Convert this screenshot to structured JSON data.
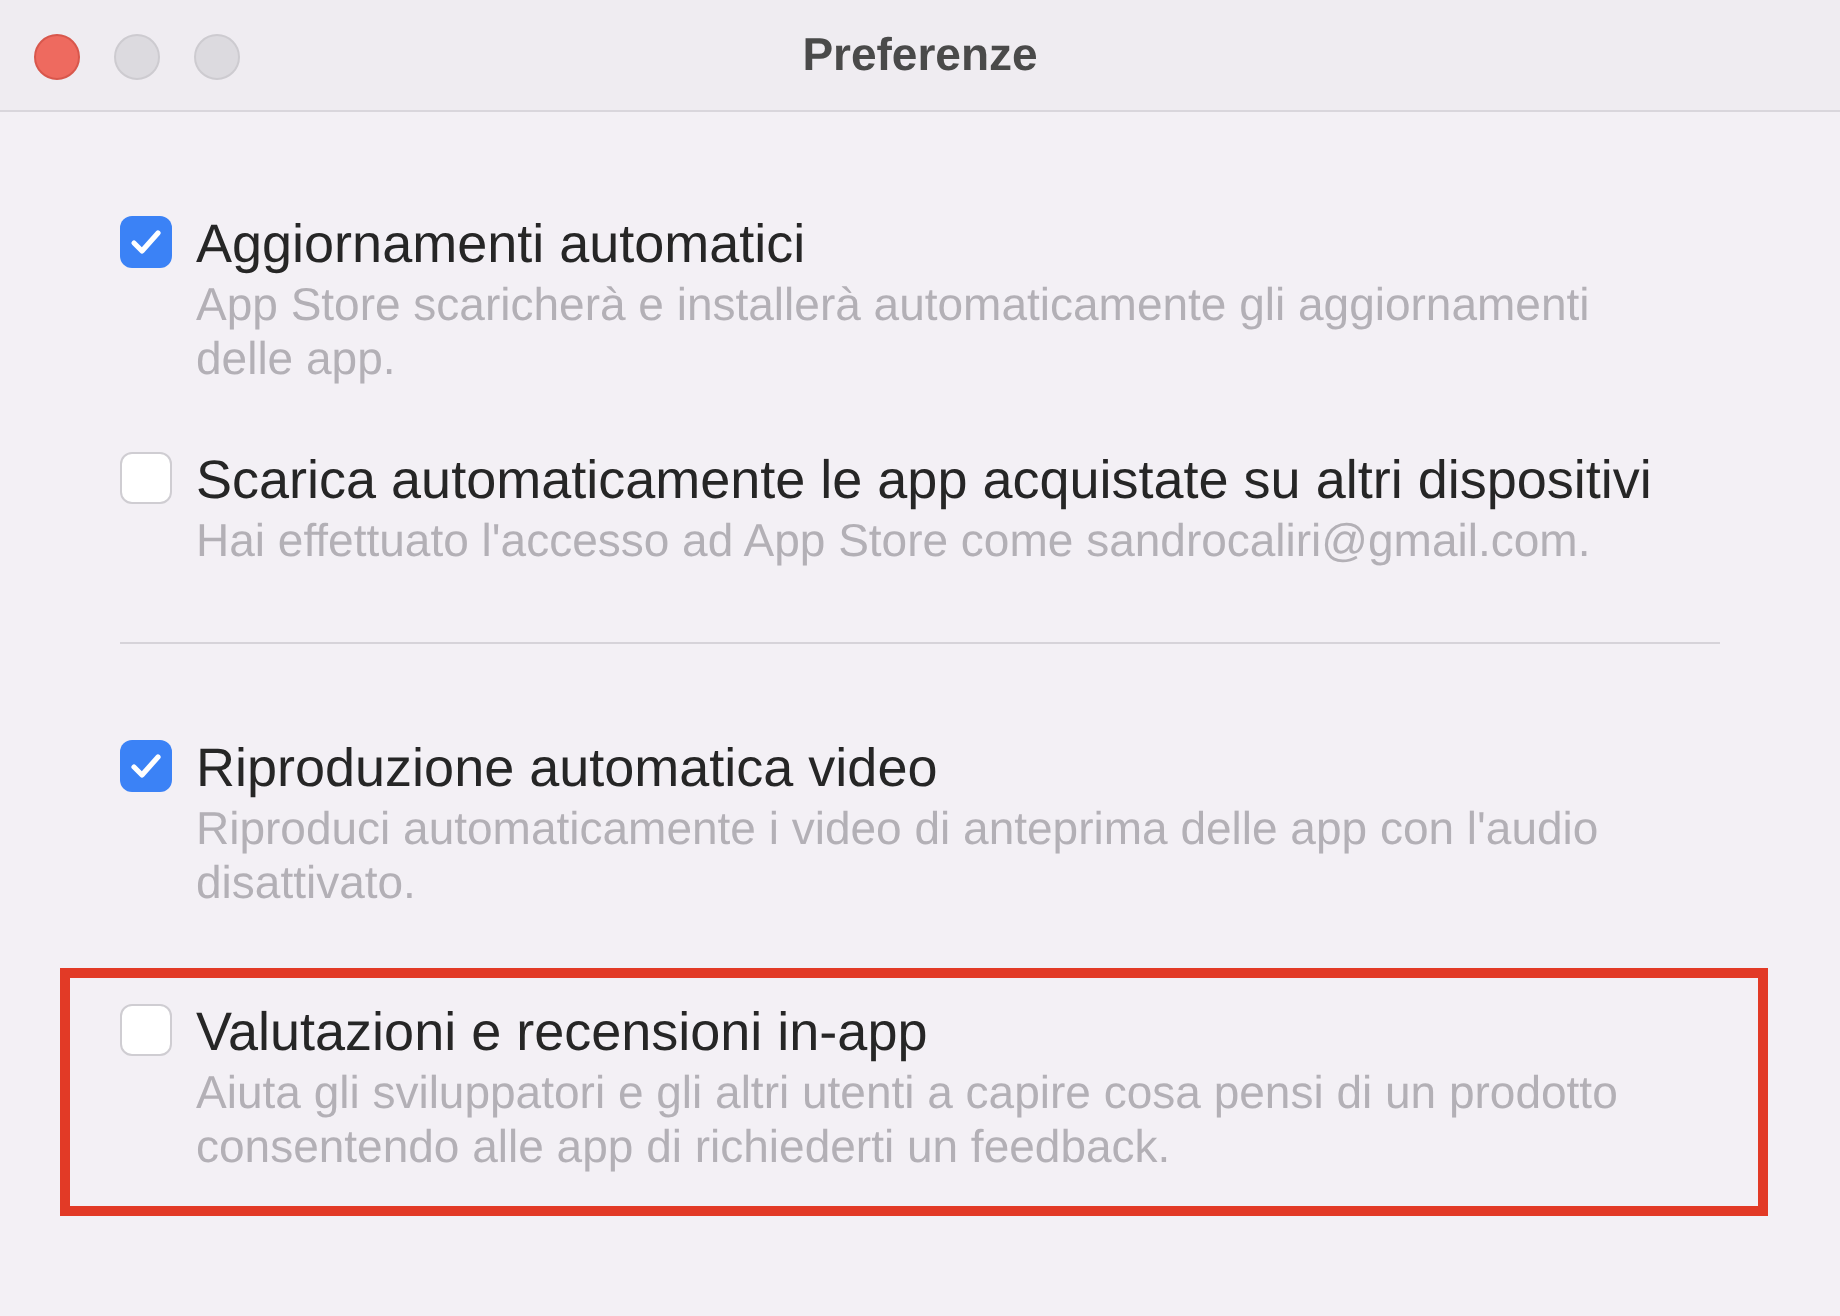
{
  "window": {
    "title": "Preferenze"
  },
  "groups": [
    {
      "items": [
        {
          "label": "Aggiornamenti automatici",
          "description": "App Store scaricherà e installerà automaticamente gli aggiornamenti delle app.",
          "checked": true,
          "highlighted": false
        },
        {
          "label": "Scarica automaticamente le app acquistate su altri dispositivi",
          "description": "Hai effettuato l'accesso ad App Store come sandrocaliri@gmail.com.",
          "checked": false,
          "highlighted": false
        }
      ]
    },
    {
      "items": [
        {
          "label": "Riproduzione automatica video",
          "description": "Riproduci automaticamente i video di anteprima delle app con l'audio disattivato.",
          "checked": true,
          "highlighted": false
        },
        {
          "label": "Valutazioni e recensioni in-app",
          "description": "Aiuta gli sviluppatori e gli altri utenti a capire cosa pensi di un prodotto consentendo alle app di richiederti un feedback.",
          "checked": false,
          "highlighted": true
        }
      ]
    }
  ]
}
